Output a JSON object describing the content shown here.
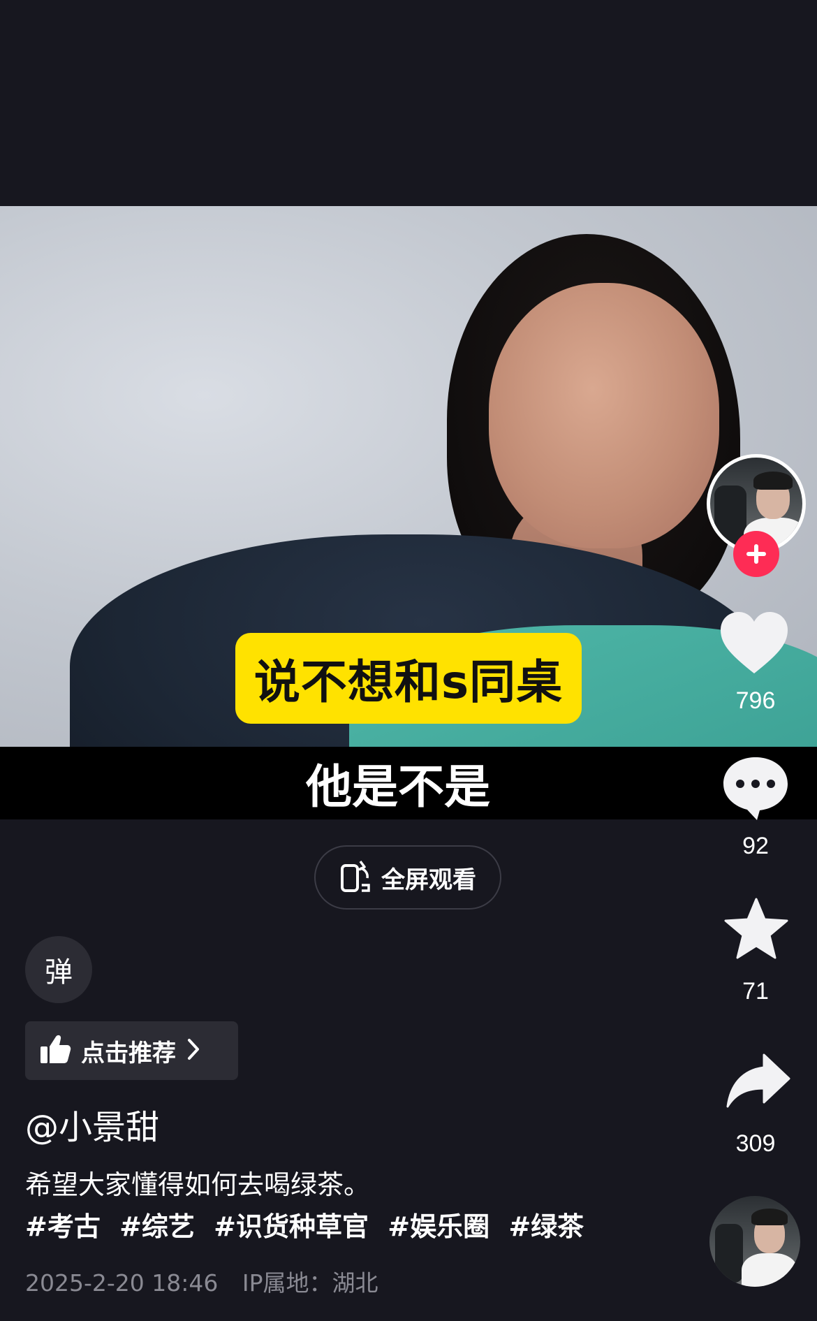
{
  "video": {
    "caption_yellow": "说不想和s同桌",
    "subtitle": "他是不是"
  },
  "fullscreen_button": {
    "label": "全屏观看",
    "icon": "rotate-screen-icon"
  },
  "rail": {
    "likes": "796",
    "comments": "92",
    "favorites": "71",
    "shares": "309"
  },
  "danmu_button": {
    "label": "弹"
  },
  "recommend_button": {
    "label": "点击推荐"
  },
  "post": {
    "author": "@小景甜",
    "description": "希望大家懂得如何去喝绿茶。",
    "tags": [
      "#考古",
      "#综艺",
      "#识货种草官",
      "#娱乐圈",
      "#绿茶"
    ],
    "datetime": "2025-2-20 18:46",
    "ip_location": "IP属地：湖北"
  },
  "colors": {
    "background": "#17171f",
    "follow": "#fe2c55",
    "caption": "#ffe200"
  }
}
